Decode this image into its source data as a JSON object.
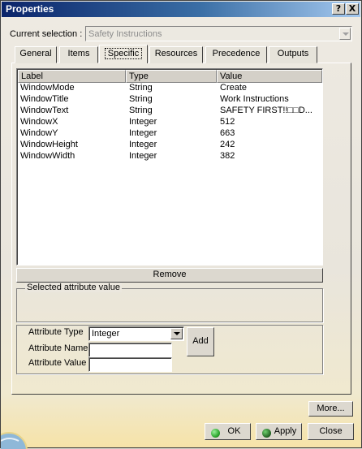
{
  "window": {
    "title": "Properties",
    "help_label": "?",
    "close_label": "X"
  },
  "selection": {
    "label": "Current selection :",
    "value": "Safety Instructions"
  },
  "tabs": [
    {
      "label": "General"
    },
    {
      "label": "Items"
    },
    {
      "label": "Specific"
    },
    {
      "label": "Resources"
    },
    {
      "label": "Precedence"
    },
    {
      "label": "Outputs"
    }
  ],
  "table": {
    "headers": [
      "Label",
      "Type",
      "Value"
    ],
    "rows": [
      [
        "WindowMode",
        "String",
        "Create"
      ],
      [
        "WindowTitle",
        "String",
        "Work Instructions"
      ],
      [
        "WindowText",
        "String",
        "SAFETY FIRST!!□□D..."
      ],
      [
        "WindowX",
        "Integer",
        "512"
      ],
      [
        "WindowY",
        "Integer",
        "663"
      ],
      [
        "WindowHeight",
        "Integer",
        "242"
      ],
      [
        "WindowWidth",
        "Integer",
        "382"
      ]
    ]
  },
  "remove_label": "Remove",
  "selected_value_group": {
    "title": "Selected attribute value"
  },
  "attribute": {
    "type_label": "Attribute Type",
    "type_value": "Integer",
    "name_label": "Attribute Name",
    "name_value": "",
    "value_label": "Attribute Value",
    "value_value": "",
    "add_label": "Add"
  },
  "footer": {
    "more_label": "More...",
    "ok_label": "OK",
    "apply_label": "Apply",
    "close_label": "Close"
  },
  "colors": {
    "ok_dot": "#2fa82f",
    "apply_dot": "#2a6e2a",
    "title_start": "#0a246a",
    "title_end": "#a6caf0"
  }
}
